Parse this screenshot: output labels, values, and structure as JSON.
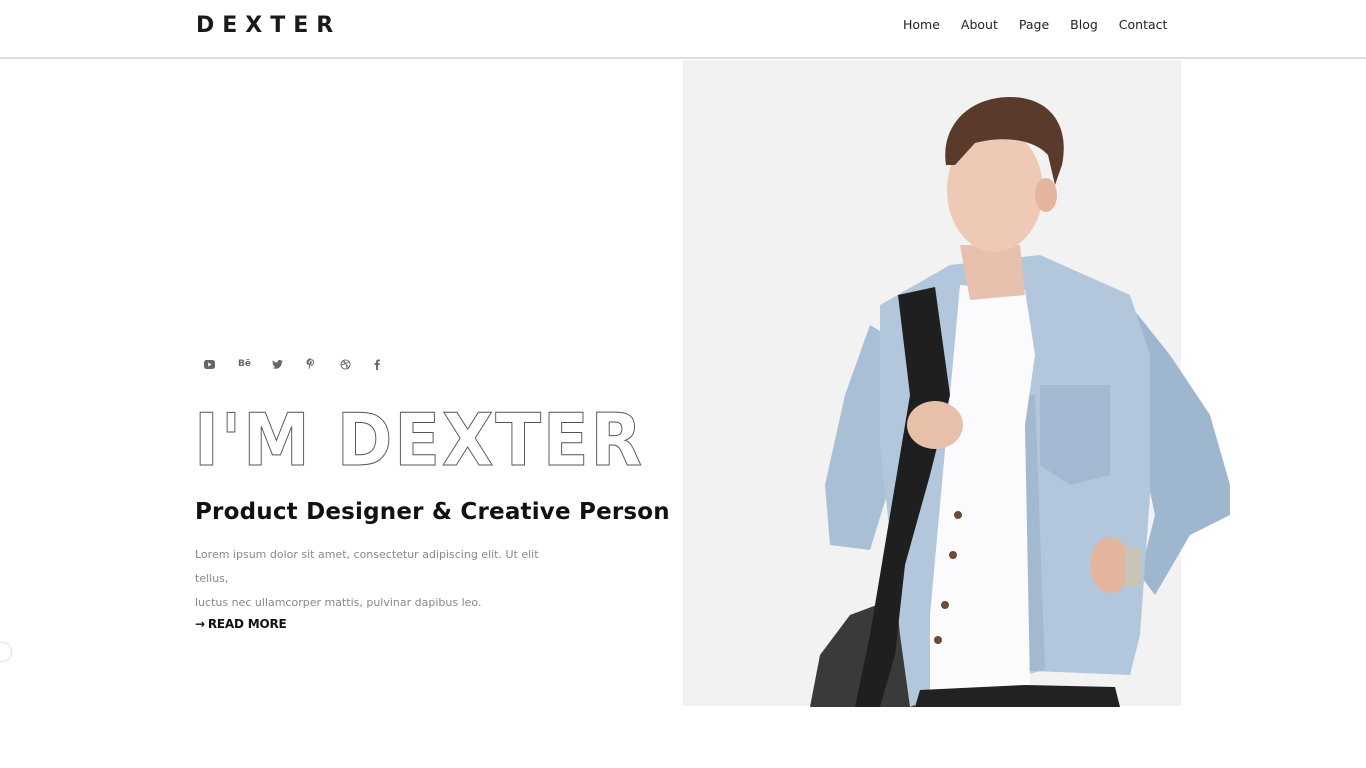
{
  "header": {
    "logo": "DEXTER",
    "nav": [
      {
        "label": "Home"
      },
      {
        "label": "About"
      },
      {
        "label": "Page"
      },
      {
        "label": "Blog"
      },
      {
        "label": "Contact"
      }
    ]
  },
  "hero": {
    "socials": [
      {
        "name": "youtube-icon",
        "glyph": "youtube"
      },
      {
        "name": "behance-icon",
        "glyph": "Bē"
      },
      {
        "name": "twitter-icon",
        "glyph": "twitter"
      },
      {
        "name": "pinterest-icon",
        "glyph": "pinterest"
      },
      {
        "name": "dribbble-icon",
        "glyph": "dribbble"
      },
      {
        "name": "facebook-icon",
        "glyph": "f"
      }
    ],
    "title": "I'M DEXTER",
    "subtitle": "Product Designer & Creative Person",
    "description_line1": "Lorem ipsum dolor sit amet, consectetur adipiscing elit. Ut elit tellus,",
    "description_line2": "luctus nec ullamcorper mattis, pulvinar dapibus leo.",
    "cta_arrow": "→",
    "cta_label": "READ MORE",
    "photo_alt": "Young man in denim jacket with shoulder bag"
  },
  "colors": {
    "text_dark": "#111111",
    "text_muted": "#888888",
    "photo_bg": "#f2f2f2",
    "icon_grey": "#666666"
  }
}
